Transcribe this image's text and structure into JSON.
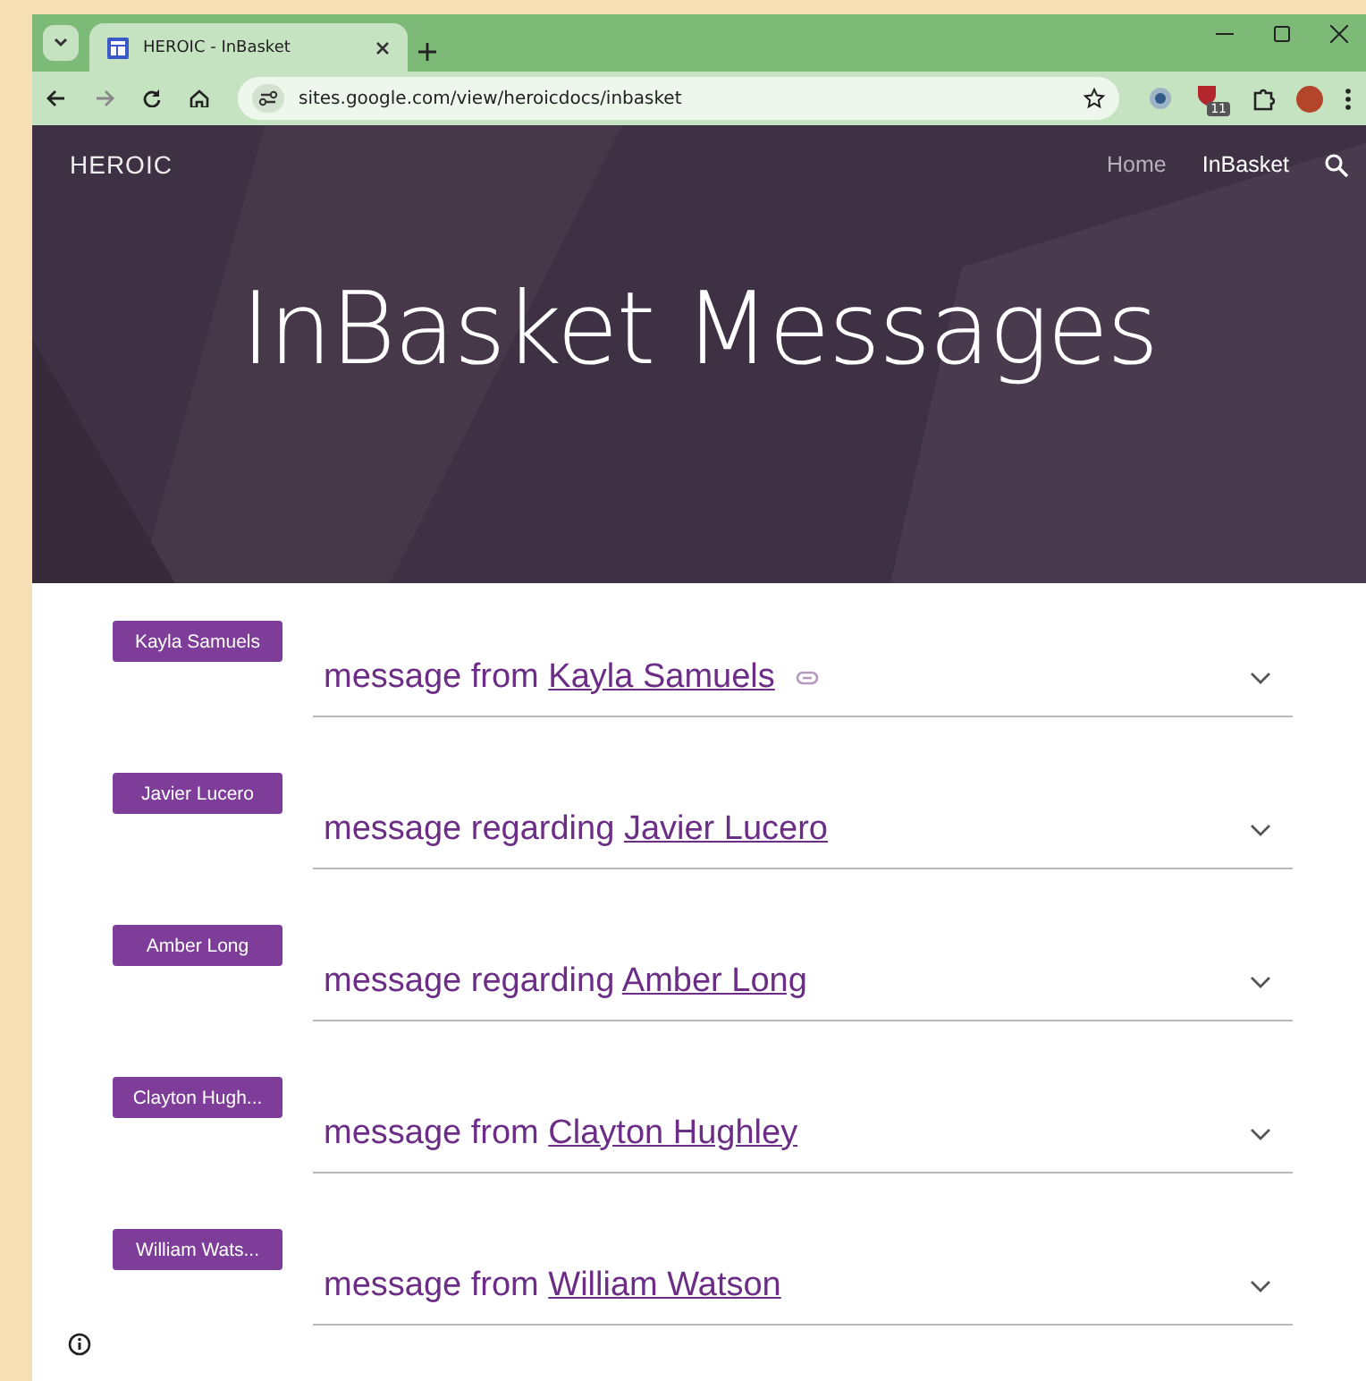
{
  "browser": {
    "tab_title": "HEROIC - InBasket",
    "address": "sites.google.com/view/heroicdocs/inbasket",
    "extension_badge": "11"
  },
  "site": {
    "logo": "HEROIC",
    "nav": [
      {
        "label": "Home",
        "selected": false
      },
      {
        "label": "InBasket",
        "selected": true
      }
    ],
    "title": "InBasket Messages"
  },
  "messages": [
    {
      "tag": "Kayla Samuels",
      "prefix": "message from",
      "name": "Kayla Samuels",
      "link_icon": true
    },
    {
      "tag": "Javier Lucero",
      "prefix": "message regarding",
      "name": "Javier Lucero",
      "link_icon": false
    },
    {
      "tag": "Amber Long",
      "prefix": "message regarding",
      "name": "Amber Long",
      "link_icon": false
    },
    {
      "tag": "Clayton Hugh...",
      "prefix": "message from",
      "name": "Clayton Hughley",
      "link_icon": false
    },
    {
      "tag": "William Wats...",
      "prefix": "message from",
      "name": "William Watson",
      "link_icon": false
    }
  ]
}
